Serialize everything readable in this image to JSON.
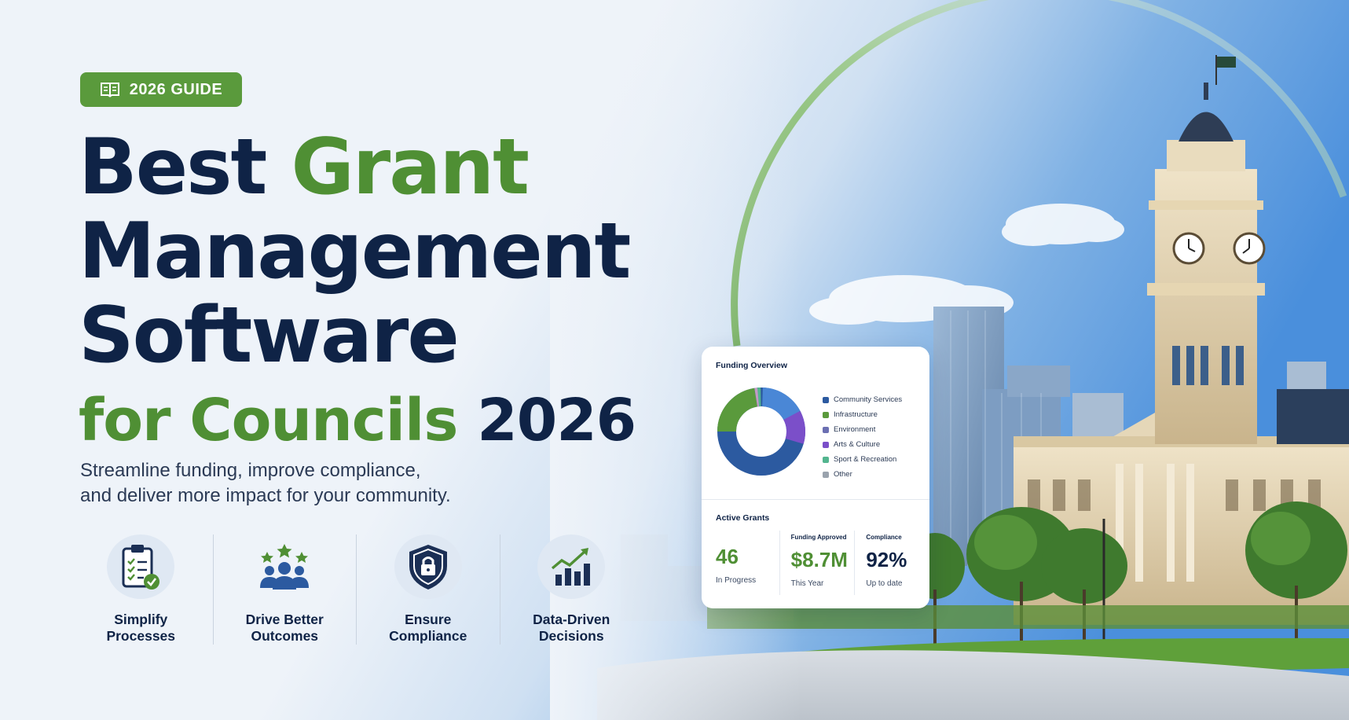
{
  "badge": {
    "label": "2026 GUIDE",
    "icon": "book-icon"
  },
  "title": {
    "word1": "Best",
    "word2": "Grant",
    "line2": "Management",
    "line3": "Software",
    "line4_green": "for Councils",
    "line4_year": "2026"
  },
  "subtitle": {
    "line1": "Streamline funding, improve compliance,",
    "line2": "and deliver more impact for your community."
  },
  "features": [
    {
      "line1": "Simplify",
      "line2": "Processes",
      "icon": "checklist-icon"
    },
    {
      "line1": "Drive Better",
      "line2": "Outcomes",
      "icon": "community-stars-icon"
    },
    {
      "line1": "Ensure",
      "line2": "Compliance",
      "icon": "shield-lock-icon"
    },
    {
      "line1": "Data-Driven",
      "line2": "Decisions",
      "icon": "bar-chart-growth-icon"
    }
  ],
  "card": {
    "title": "Funding Overview",
    "legend": [
      {
        "label": "Community Services",
        "color": "#2c5aa0"
      },
      {
        "label": "Infrastructure",
        "color": "#5a9a3c"
      },
      {
        "label": "Environment",
        "color": "#6b6fb2"
      },
      {
        "label": "Arts & Culture",
        "color": "#7b4fc9"
      },
      {
        "label": "Sport & Recreation",
        "color": "#53b58f"
      },
      {
        "label": "Other",
        "color": "#9aa3ad"
      }
    ],
    "active_title": "Active Grants",
    "stats": [
      {
        "caption": "",
        "value": "46",
        "sub": "In Progress"
      },
      {
        "caption": "Funding Approved",
        "value": "$8.7M",
        "sub": "This Year"
      },
      {
        "caption": "Compliance",
        "value": "92%",
        "sub": "Up to date"
      }
    ]
  },
  "colors": {
    "navy": "#0f2346",
    "green": "#4f8f34",
    "badge_green": "#5a9a3c"
  }
}
